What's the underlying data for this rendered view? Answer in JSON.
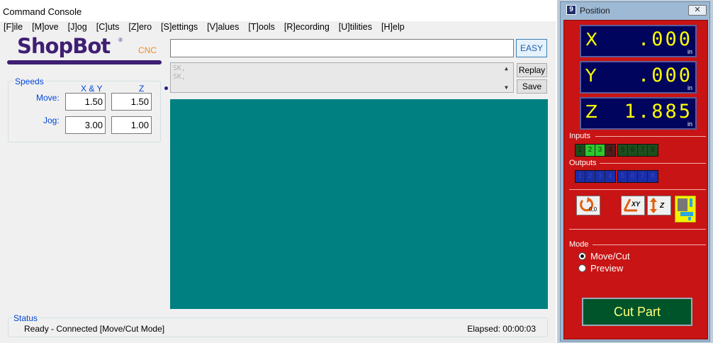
{
  "console": {
    "title": "Command Console",
    "menu": [
      "[F]ile",
      "[M]ove",
      "[J]og",
      "[C]uts",
      "[Z]ero",
      "[S]ettings",
      "[V]alues",
      "[T]ools",
      "[R]ecording",
      "[U]tilities",
      "[H]elp"
    ],
    "logo": {
      "brand": "ShopBot",
      "reg": "®",
      "suffix": "CNC"
    },
    "speeds": {
      "legend": "Speeds",
      "col_xy": "X & Y",
      "col_z": "Z",
      "move_label": "Move:",
      "jog_label": "Jog:",
      "move_xy": "1.50",
      "move_z": "1.50",
      "jog_xy": "3.00",
      "jog_z": "1.00"
    },
    "command_value": "",
    "easy_label": "EASY",
    "history": [
      "SK,",
      "SK,"
    ],
    "replay_label": "Replay",
    "save_label": "Save",
    "status": {
      "legend": "Status",
      "text": "Ready - Connected  [Move/Cut Mode]",
      "elapsed": "Elapsed: 00:00:03"
    },
    "colors": {
      "preview_bg": "#008080",
      "accent": "#0046d5"
    }
  },
  "position": {
    "title": "Position",
    "icon_char": "9",
    "close": "✕",
    "dro": [
      {
        "axis": "X",
        "value": ".000",
        "unit": "in"
      },
      {
        "axis": "Y",
        "value": ".000",
        "unit": "in"
      },
      {
        "axis": "Z",
        "value": "1.885",
        "unit": "in"
      }
    ],
    "inputs_label": "Inputs",
    "inputs": [
      "1",
      "2",
      "3",
      "4",
      "5",
      "6",
      "7",
      "8"
    ],
    "inputs_active": [
      false,
      true,
      true,
      false,
      false,
      false,
      false,
      false
    ],
    "outputs_label": "Outputs",
    "outputs": [
      "1",
      "2",
      "3",
      "4",
      "5",
      "6",
      "7",
      "8"
    ],
    "tools": {
      "zero_label": "0,0",
      "xy_label": "XY",
      "z_label": "Z"
    },
    "mode": {
      "label": "Mode",
      "options": [
        "Move/Cut",
        "Preview"
      ],
      "selected": "Move/Cut"
    },
    "cut_part_label": "Cut Part",
    "colors": {
      "panel": "#c81414",
      "dro_bg": "#00045c",
      "dro_text": "#ffff00",
      "cut_bg": "#00542a"
    }
  }
}
